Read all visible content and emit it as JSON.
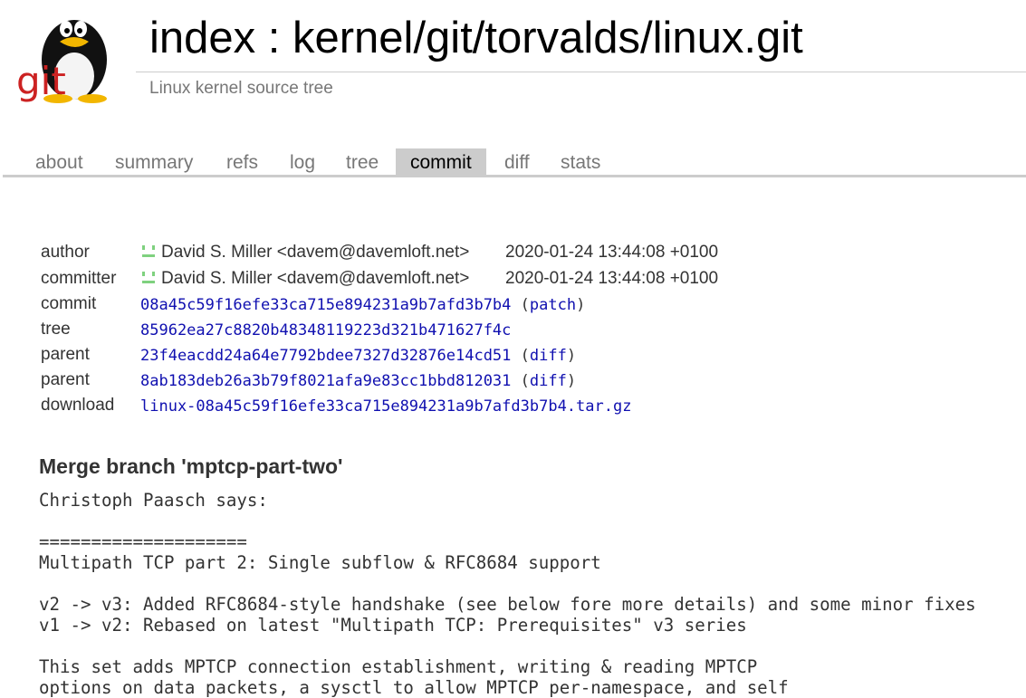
{
  "header": {
    "title": "index : kernel/git/torvalds/linux.git",
    "subtitle": "Linux kernel source tree",
    "logo_text": "git"
  },
  "tabs": [
    "about",
    "summary",
    "refs",
    "log",
    "tree",
    "commit",
    "diff",
    "stats"
  ],
  "active_tab": "commit",
  "commit_info": {
    "author": {
      "label": "author",
      "name": "David S. Miller <davem@davemloft.net>",
      "date": "2020-01-24 13:44:08 +0100"
    },
    "committer": {
      "label": "committer",
      "name": "David S. Miller <davem@davemloft.net>",
      "date": "2020-01-24 13:44:08 +0100"
    },
    "commit": {
      "label": "commit",
      "hash": "08a45c59f16efe33ca715e894231a9b7afd3b7b4",
      "link": "patch"
    },
    "tree": {
      "label": "tree",
      "hash": "85962ea27c8820b48348119223d321b471627f4c"
    },
    "parents": [
      {
        "label": "parent",
        "hash": "23f4eacdd24a64e7792bdee7327d32876e14cd51",
        "link": "diff"
      },
      {
        "label": "parent",
        "hash": "8ab183deb26a3b79f8021afa9e83cc1bbd812031",
        "link": "diff"
      }
    ],
    "download": {
      "label": "download",
      "file": "linux-08a45c59f16efe33ca715e894231a9b7afd3b7b4.tar.gz"
    }
  },
  "commit_subject": "Merge branch 'mptcp-part-two'",
  "commit_message": "Christoph Paasch says:\n\n====================\nMultipath TCP part 2: Single subflow & RFC8684 support\n\nv2 -> v3: Added RFC8684-style handshake (see below fore more details) and some minor fixes\nv1 -> v2: Rebased on latest \"Multipath TCP: Prerequisites\" v3 series\n\nThis set adds MPTCP connection establishment, writing & reading MPTCP\noptions on data packets, a sysctl to allow MPTCP per-namespace, and self",
  "colors": {
    "link": "#1010b0",
    "tab_active_bg": "#cccccc",
    "muted_text": "#777777",
    "avatar": "#7fd17f"
  }
}
